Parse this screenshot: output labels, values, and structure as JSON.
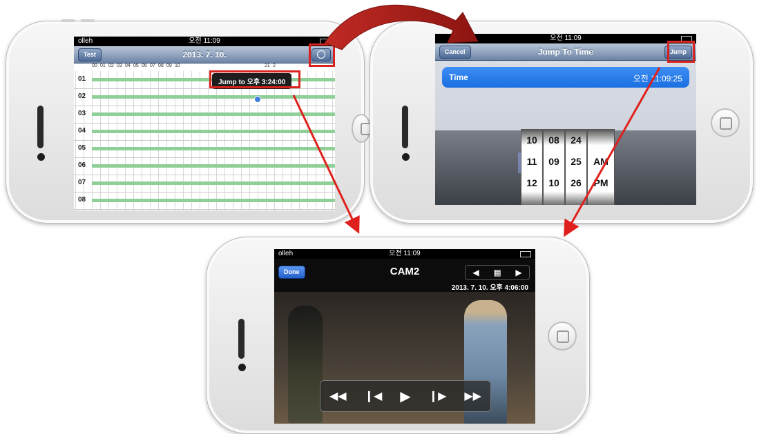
{
  "phone1": {
    "status": {
      "carrier": "olleh",
      "time": "오전 11:09"
    },
    "nav": {
      "back_label": "Test",
      "title": "2013. 7. 10."
    },
    "hours": [
      "00",
      "01",
      "02",
      "03",
      "04",
      "05",
      "06",
      "07",
      "08",
      "09",
      "10",
      "",
      "",
      "",
      "",
      "",
      "",
      "",
      "",
      "",
      "21",
      "2"
    ],
    "channels": [
      "01",
      "02",
      "03",
      "04",
      "05",
      "06",
      "07",
      "08"
    ],
    "tooltip": "Jump to 오후 3:24:00"
  },
  "phone2": {
    "status": {
      "time": "오전 11:09"
    },
    "nav": {
      "cancel_label": "Cancel",
      "title": "Jump To Time",
      "jump_label": "Jump"
    },
    "time_row": {
      "label": "Time",
      "value": "오전 11:09:25"
    },
    "picker": {
      "hour": [
        "10",
        "11",
        "12"
      ],
      "minute": [
        "08",
        "09",
        "10"
      ],
      "second": [
        "24",
        "25",
        "26"
      ],
      "ampm": [
        "",
        "AM",
        "PM"
      ]
    }
  },
  "phone3": {
    "status": {
      "carrier": "olleh",
      "time": "오전 11:09"
    },
    "nav": {
      "done_label": "Done",
      "title": "CAM2"
    },
    "timestamp": "2013. 7. 10. 오후 4:06:00"
  },
  "colors": {
    "highlight": "#d9231f",
    "record_bar": "#8fcf98",
    "selected_row": "#1a6fe0"
  }
}
